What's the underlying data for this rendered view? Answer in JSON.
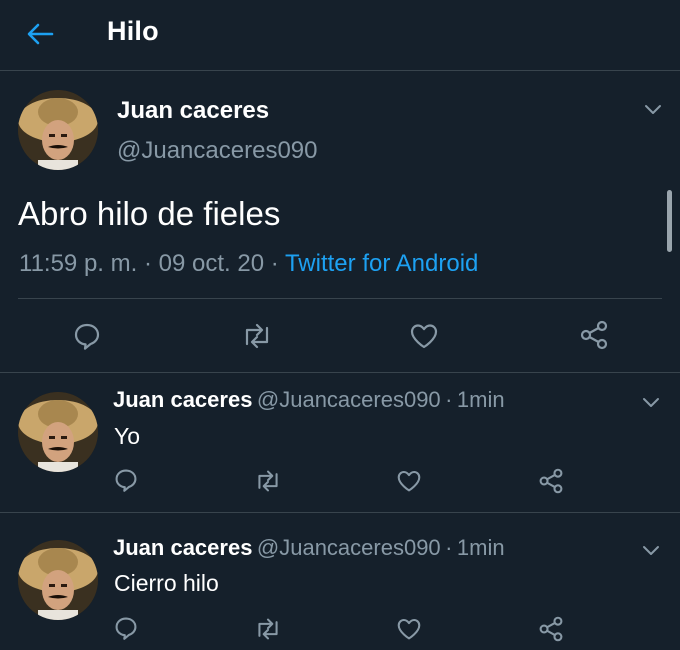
{
  "header": {
    "title": "Hilo"
  },
  "main_tweet": {
    "name": "Juan caceres",
    "handle": "@Juancaceres090",
    "text": "Abro hilo de fieles",
    "time": "11:59 p. m.",
    "date": "09 oct. 20",
    "source": "Twitter for Android",
    "sep": "·"
  },
  "replies": [
    {
      "name": "Juan caceres",
      "handle": "@Juancaceres090",
      "time": "1min",
      "text": "Yo"
    },
    {
      "name": "Juan caceres",
      "handle": "@Juancaceres090",
      "time": "1min",
      "text": "Cierro hilo"
    }
  ],
  "icons": [
    "back-arrow-icon",
    "chevron-down-icon",
    "reply-icon",
    "retweet-icon",
    "like-icon",
    "share-icon"
  ],
  "colors": {
    "background": "#15202b",
    "accent": "#1da1f2",
    "secondary_text": "#8899a6",
    "divider": "#38444d"
  }
}
